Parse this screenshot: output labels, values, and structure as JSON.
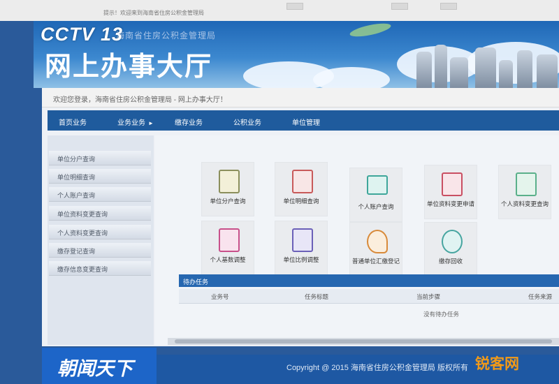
{
  "overlay": {
    "channel_logo": "CCTV 13",
    "program_name": "朝闻天下",
    "watermark": "锐客网"
  },
  "browser": {
    "tab_text": "提示！欢迎来到海南省住房公积金管理局"
  },
  "site": {
    "subtitle": "海南省住房公积金管理局",
    "title": "网上办事大厅",
    "welcome": "欢迎您登录，海南省住房公积金管理局 - 网上办事大厅！",
    "nav": [
      {
        "label": "首页业务"
      },
      {
        "label": "业务业务",
        "arrow": "►"
      },
      {
        "label": "缴存业务"
      },
      {
        "label": "公积业务"
      },
      {
        "label": "单位管理"
      }
    ],
    "left_menu": [
      "单位分户查询",
      "单位明细查询",
      "个人账户查询",
      "单位资料变更查询",
      "个人资料变更查询",
      "缴存登记查询",
      "缴存信息变更查询"
    ],
    "tiles": [
      {
        "label": "单位分户查询",
        "color": "#8b8f5c"
      },
      {
        "label": "单位明细查询",
        "color": "#c85a5a"
      },
      {
        "label": "个人账户查询",
        "color": "#3ea69a"
      },
      {
        "label": "单位资料变更申请",
        "color": "#c94f62"
      },
      {
        "label": "个人资料变更查询",
        "color": "#5ab08a"
      },
      {
        "label": "个人基数调整",
        "color": "#c8508a"
      },
      {
        "label": "单位比例调整",
        "color": "#6b60b8"
      },
      {
        "label": "普通单位汇缴登记",
        "color": "#d88a3a"
      },
      {
        "label": "缴存回收",
        "color": "#47a5a0"
      }
    ],
    "section_title": "待办任务",
    "table_headers": [
      "业务号",
      "任务标题",
      "当前步骤",
      "任务来源"
    ],
    "empty_text": "没有待办任务",
    "footer": "Copyright @ 2015 海南省住房公积金管理局 版权所有"
  }
}
